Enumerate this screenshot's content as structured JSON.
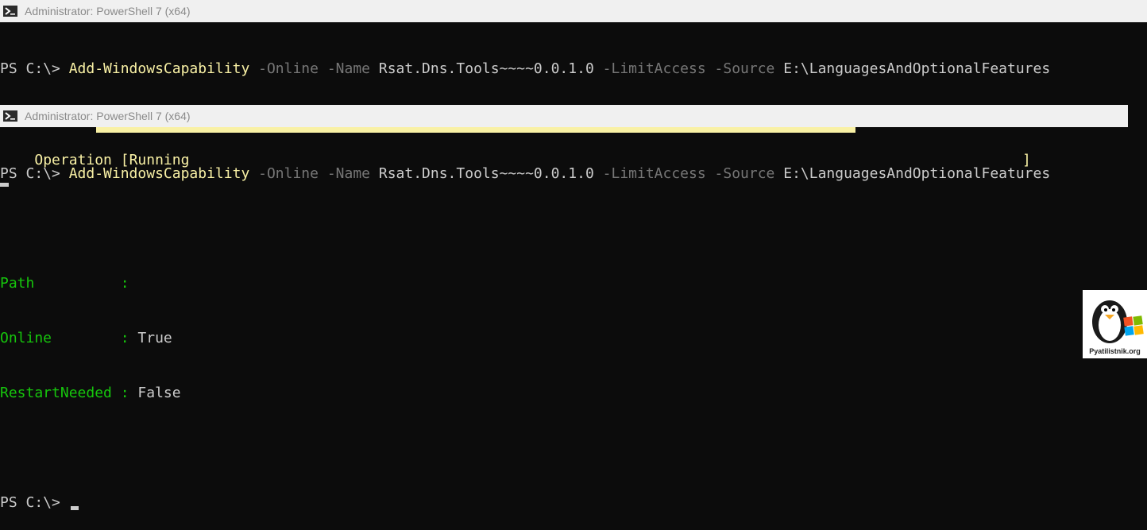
{
  "window1": {
    "title": "Administrator: PowerShell 7 (x64)",
    "prompt": "PS C:\\> ",
    "cmdlet": "Add-WindowsCapability",
    "param_online": "-Online",
    "param_name": "-Name",
    "name_value": "Rsat.Dns.Tools~~~~0.0.1.0",
    "param_limit": "-LimitAccess",
    "param_source": "-Source",
    "source_value": "E:\\LanguagesAndOptionalFeatures",
    "progress_label": "Operation [",
    "progress_status": "Running",
    "progress_close": "]",
    "progress_fraction": 0.82
  },
  "window2": {
    "title": "Administrator: PowerShell 7 (x64)",
    "prompt": "PS C:\\> ",
    "cmdlet": "Add-WindowsCapability",
    "param_online": "-Online",
    "param_name": "-Name",
    "name_value": "Rsat.Dns.Tools~~~~0.0.1.0",
    "param_limit": "-LimitAccess",
    "param_source": "-Source",
    "source_value": "E:\\LanguagesAndOptionalFeatures",
    "result": [
      {
        "key": "Path          ",
        "sep": ":",
        "value": ""
      },
      {
        "key": "Online        ",
        "sep": ":",
        "value": "True"
      },
      {
        "key": "RestartNeeded ",
        "sep": ":",
        "value": "False"
      }
    ],
    "final_prompt": "PS C:\\> "
  },
  "watermark": {
    "text": "Pyatilistnik.org"
  },
  "colors": {
    "background": "#0c0c0c",
    "cmdlet": "#f9f1a5",
    "parameter": "#767676",
    "key": "#16c60c",
    "progress": "#f9f1a5"
  }
}
